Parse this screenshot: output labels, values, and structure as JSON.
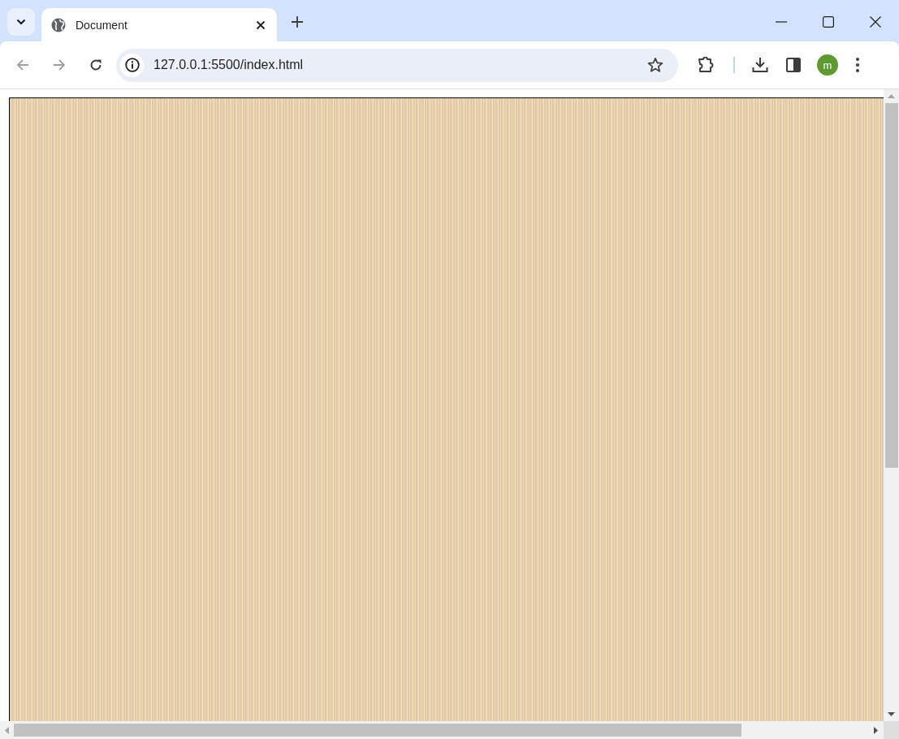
{
  "tabs": [
    {
      "title": "Document",
      "selected": true
    }
  ],
  "address_bar": {
    "url": "127.0.0.1:5500/index.html"
  },
  "profile": {
    "initial": "m"
  }
}
